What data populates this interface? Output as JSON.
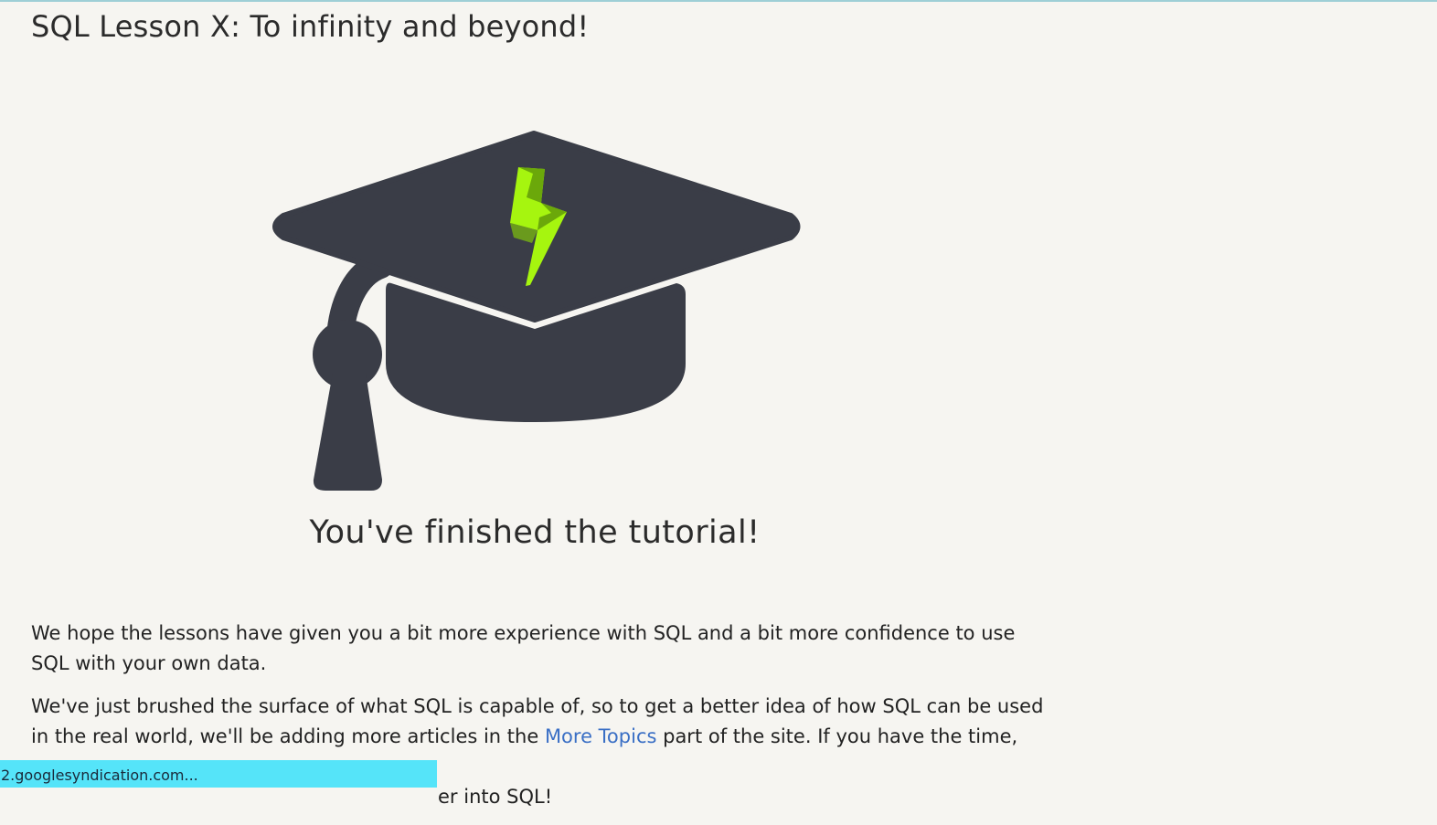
{
  "lesson": {
    "title": "SQL Lesson X: To infinity and beyond!",
    "finish_caption": "You've finished the tutorial!"
  },
  "content": {
    "paragraph1": "We hope the lessons have given you a bit more experience with SQL and a bit more confidence to use SQL with your own data.",
    "paragraph2_before_link": "We've just brushed the surface of what SQL is capable of, so to get a better idea of how SQL can be used in the real world, we'll be adding more articles in the ",
    "paragraph2_link": "More Topics",
    "paragraph2_after_link": " part of the site. If you have the time, we",
    "paragraph2_tail": "er into SQL!"
  },
  "status_bar": {
    "text": "2.googlesyndication.com..."
  },
  "icons": {
    "hat": "graduation-cap-icon",
    "bolt": "lightning-bolt-icon"
  },
  "colors": {
    "hat": "#3a3d47",
    "bolt": "#a6f50f",
    "bolt_shade": "#6ba80a",
    "link": "#3a6fc5",
    "status_bar": "#55e4f9"
  }
}
